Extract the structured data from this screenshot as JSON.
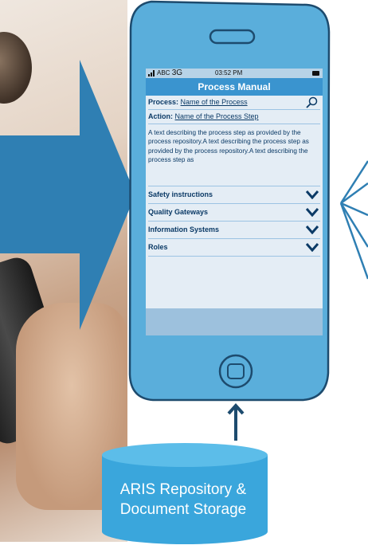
{
  "colors": {
    "accent": "#3a94cf",
    "repository": "#3aa6dc",
    "frame_fill": "#5aaedb",
    "text": "#0b3a66"
  },
  "status_bar": {
    "carrier": "ABC",
    "network": "3G",
    "time": "03:52 PM"
  },
  "app": {
    "title": "Process Manual"
  },
  "fields": {
    "process_label": "Process:",
    "process_value": "Name of the Process",
    "action_label": "Action:",
    "action_value": "Name of the Process Step"
  },
  "description": "A text describing the process step as provided by the process repository.A text describing the process step as provided by the process repository.A text describing the process step as",
  "sections": [
    {
      "label": "Safety instructions"
    },
    {
      "label": "Quality Gateways"
    },
    {
      "label": "Information Systems"
    },
    {
      "label": "Roles"
    }
  ],
  "repository": {
    "line1": "ARIS Repository &",
    "line2": "Document Storage"
  },
  "icons": {
    "search": "magnifier-icon",
    "expand": "chevron-down-icon",
    "home": "home-button-icon",
    "signal": "signal-bars-icon",
    "battery": "battery-icon"
  }
}
